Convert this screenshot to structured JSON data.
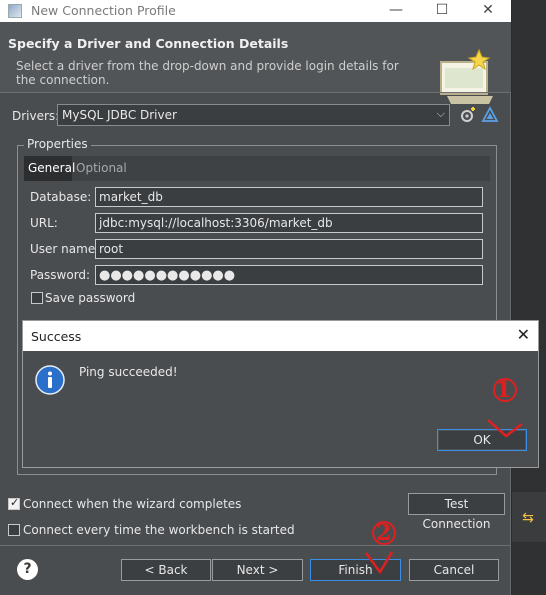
{
  "window": {
    "title": "New Connection Profile",
    "minimize": "—",
    "maximize": "☐",
    "close": "✕"
  },
  "header": {
    "title": "Specify a Driver and Connection Details",
    "description": "Select a driver from the drop-down and provide login details for the connection."
  },
  "drivers": {
    "label": "Drivers:",
    "selected": "MySQL JDBC Driver"
  },
  "properties": {
    "group_title": "Properties",
    "tabs": [
      "General",
      "Optional"
    ],
    "database_label": "Database:",
    "database_value": "market_db",
    "url_label": "URL:",
    "url_value": "jdbc:mysql://localhost:3306/market_db",
    "username_label": "User name:",
    "username_value": "root",
    "password_label": "Password:",
    "password_value": "●●●●●●●●●●●●",
    "save_password_label": "Save password",
    "save_password_checked": false
  },
  "options": {
    "connect_when_complete_label": "Connect when the wizard completes",
    "connect_when_complete_checked": true,
    "connect_every_time_label": "Connect every time the workbench is started",
    "connect_every_time_checked": false,
    "test_connection_label": "Test Connection"
  },
  "buttons": {
    "back": "< Back",
    "next": "Next >",
    "finish": "Finish",
    "cancel": "Cancel",
    "help": "?"
  },
  "dialog": {
    "title": "Success",
    "close": "✕",
    "message": "Ping succeeded!",
    "ok": "OK"
  },
  "annotations": {
    "marker_1": "1",
    "marker_2": "2",
    "color": "#e02020"
  },
  "colors": {
    "background": "#4a4d50",
    "focus": "#3a8ee6",
    "info_icon": "#2a6fc9"
  }
}
